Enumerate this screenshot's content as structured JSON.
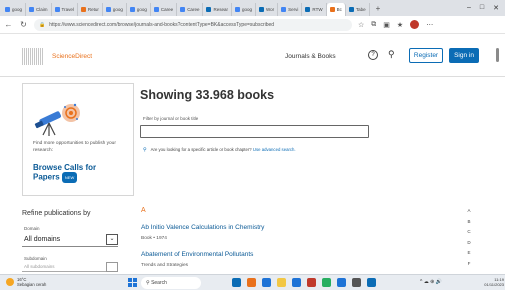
{
  "browser": {
    "tabs": [
      {
        "label": "goog",
        "color": "#4285f4"
      },
      {
        "label": "Claim",
        "color": "#4285f4"
      },
      {
        "label": "Travel",
        "color": "#4285f4"
      },
      {
        "label": "Retur",
        "color": "#e9711c"
      },
      {
        "label": "goog",
        "color": "#4285f4"
      },
      {
        "label": "goog",
        "color": "#4285f4"
      },
      {
        "label": "Caree",
        "color": "#4285f4"
      },
      {
        "label": "Caree",
        "color": "#4285f4"
      },
      {
        "label": "Resear",
        "color": "#0b6cb5"
      },
      {
        "label": "goog",
        "color": "#4285f4"
      },
      {
        "label": "Wor",
        "color": "#0b6cb5"
      },
      {
        "label": "Servi",
        "color": "#4285f4"
      },
      {
        "label": "RTW",
        "color": "#0b6cb5"
      },
      {
        "label": "Bc",
        "color": "#e9711c",
        "active": true
      },
      {
        "label": "Tabe",
        "color": "#0b6cb5"
      }
    ],
    "new_tab": "+",
    "address": "https://www.sciencedirect.com/browse/journals-and-books?contentType=BK&accessType=subscribed",
    "window_controls": [
      "–",
      "□",
      "✕"
    ]
  },
  "site": {
    "brand": "ScienceDirect",
    "nav_link": "Journals & Books",
    "help": "?",
    "register": "Register",
    "sign_in": "Sign in"
  },
  "promo": {
    "text": "Find more opportunities to publish your research:",
    "cta": "Browse Calls for Papers",
    "badge": "NEW"
  },
  "main": {
    "title": "Showing 33.968 books",
    "filter_label": "Filter by journal or book title",
    "filter_value": "",
    "hint_text": "Are you looking for a specific article or book chapter?",
    "hint_link": "Use advanced search."
  },
  "refine": {
    "title": "Refine publications by",
    "domain_label": "Domain",
    "domain_value": "All domains",
    "subdomain_label": "Subdomain",
    "subdomain_value": "All subdomains"
  },
  "books": {
    "letter": "A",
    "items": [
      {
        "title": "Ab Initio Valence Calculations in Chemistry",
        "meta": "Book • 1974"
      },
      {
        "title": "Abatement of Environmental Pollutants",
        "meta": "Trends and Strategies"
      }
    ]
  },
  "alpha_index": [
    "A",
    "B",
    "C",
    "D",
    "E",
    "F"
  ],
  "taskbar": {
    "weather_temp": "16°C",
    "weather_desc": "Sebagian cerah",
    "search": "Search",
    "app_colors": [
      "#0b6cb5",
      "#e9711c",
      "#1e73d6",
      "#f2c744",
      "#1e73d6",
      "#c0392b",
      "#27ae60",
      "#1e73d6",
      "#555555",
      "#0b6cb5"
    ],
    "tray": "^ ☁ ⊕ 🔊",
    "time": "11:19",
    "date": "01/11/2023"
  }
}
